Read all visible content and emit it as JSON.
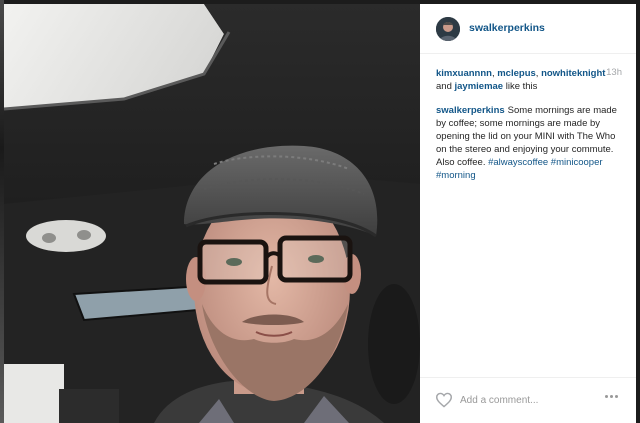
{
  "post": {
    "username": "swalkerperkins",
    "timestamp": "13h"
  },
  "likes": {
    "users": [
      "kimxuannnn",
      "mclepus",
      "nowhiteknight",
      "jaymiemae"
    ],
    "sep1": ", ",
    "sep2": ", ",
    "sep3": " and ",
    "suffix": " like this"
  },
  "caption": {
    "author": "swalkerperkins",
    "text": "Some mornings are made by coffee; some mornings are made by opening the lid on your MINI with The Who on the stereo and enjoying your commute. Also coffee.",
    "hashtags": [
      "#alwayscoffee",
      "#minicooper",
      "#morning"
    ]
  },
  "comment": {
    "placeholder": "Add a comment..."
  },
  "icons": {
    "like": "heart-outline-icon",
    "options": "more-options-icon"
  },
  "colors": {
    "link": "#125688",
    "muted": "#a5a7aa"
  }
}
